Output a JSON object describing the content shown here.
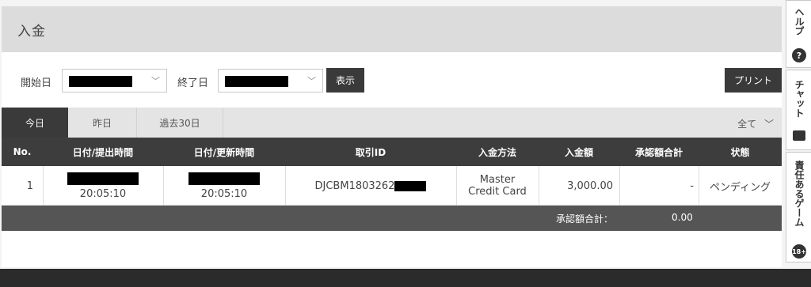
{
  "page": {
    "title": "入金"
  },
  "filter": {
    "start_label": "開始日",
    "end_label": "終了日",
    "show_button": "表示",
    "print_button": "プリント"
  },
  "tabs": [
    {
      "label": "今日",
      "active": true
    },
    {
      "label": "昨日",
      "active": false
    },
    {
      "label": "過去30日",
      "active": false
    }
  ],
  "status_filter": "全て",
  "table": {
    "headers": [
      "No.",
      "日付/提出時間",
      "日付/更新時間",
      "取引ID",
      "入金方法",
      "入金額",
      "承認額合計",
      "状態"
    ],
    "rows": [
      {
        "no": "1",
        "submit_time": "20:05:10",
        "update_time": "20:05:10",
        "txn_id": "DJCBM1803262",
        "method_line1": "Master",
        "method_line2": "Credit Card",
        "amount": "3,000.00",
        "approved_total": "-",
        "status": "ペンディング"
      }
    ],
    "total_label": "承認額合計：",
    "total_value": "0.00"
  },
  "side_tabs": {
    "help": "ヘルプ",
    "chat": "チャット",
    "responsible": "責任あるゲーム",
    "age_badge": "18+"
  },
  "icons": {
    "help": "question-circle",
    "chat": "chat-bubble",
    "chevron": "chevron-down"
  }
}
